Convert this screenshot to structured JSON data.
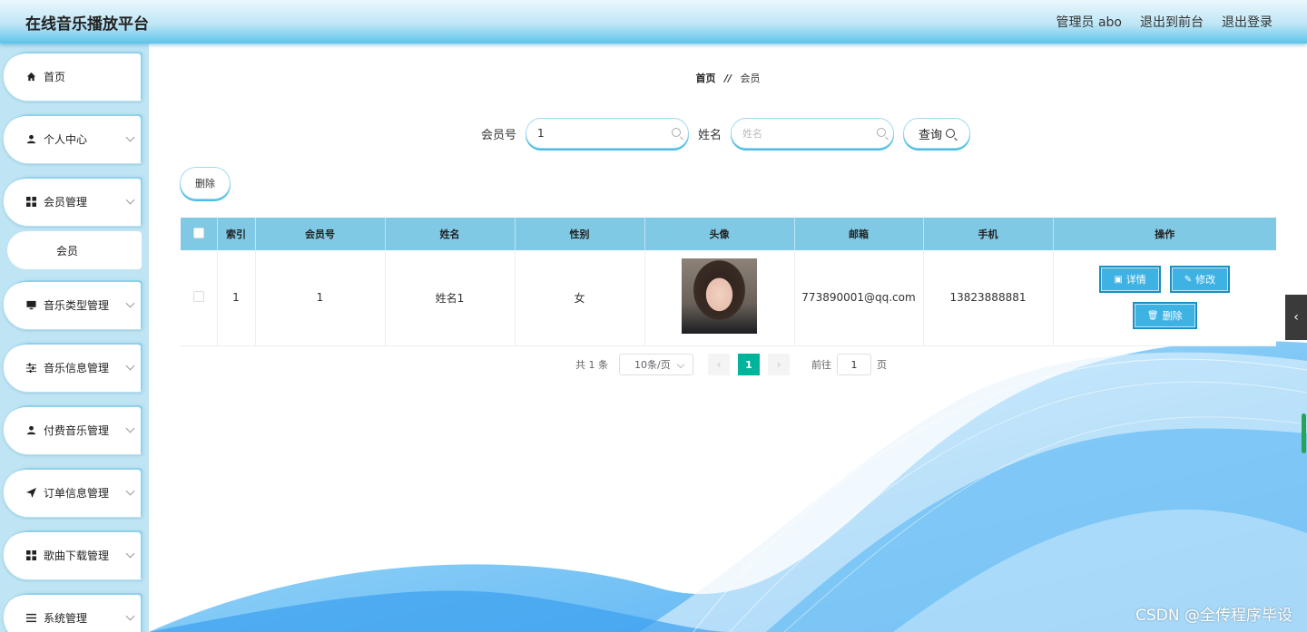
{
  "header": {
    "title": "在线音乐播放平台",
    "nav": [
      "管理员 abo",
      "退出到前台",
      "退出登录"
    ]
  },
  "sidebar": {
    "items": [
      {
        "label": "首页",
        "icon": "home-icon"
      },
      {
        "label": "个人中心",
        "icon": "user-icon"
      },
      {
        "label": "会员管理",
        "icon": "grid-icon"
      },
      {
        "label": "会员",
        "sub": true
      },
      {
        "label": "音乐类型管理",
        "icon": "monitor-icon"
      },
      {
        "label": "音乐信息管理",
        "icon": "sliders-icon"
      },
      {
        "label": "付费音乐管理",
        "icon": "user-icon"
      },
      {
        "label": "订单信息管理",
        "icon": "send-icon"
      },
      {
        "label": "歌曲下载管理",
        "icon": "grid-icon"
      },
      {
        "label": "系统管理",
        "icon": "list-icon"
      }
    ]
  },
  "breadcrumb": {
    "home": "首页",
    "sep": "//",
    "current": "会员"
  },
  "search": {
    "member_label": "会员号",
    "member_value": "1",
    "name_label": "姓名",
    "name_placeholder": "姓名",
    "query_label": "查询"
  },
  "toolbar": {
    "delete_label": "删除"
  },
  "table": {
    "columns": [
      "索引",
      "会员号",
      "姓名",
      "性别",
      "头像",
      "邮箱",
      "手机",
      "操作"
    ],
    "rows": [
      {
        "index": "1",
        "member_no": "1",
        "name": "姓名1",
        "gender": "女",
        "email": "773890001@qq.com",
        "phone": "13823888881"
      }
    ],
    "actions": {
      "detail": "详情",
      "edit": "修改",
      "delete": "删除"
    }
  },
  "pagination": {
    "total": "共 1 条",
    "page_size": "10条/页",
    "current_page": "1",
    "goto_label": "前往",
    "goto_value": "1",
    "page_suffix": "页"
  },
  "watermark": "CSDN @全传程序毕设",
  "colors": {
    "accent": "#3eb2e3",
    "header_bottom": "#5ec3ea",
    "pager_active": "#00b39b",
    "table_head": "#7fc9e4"
  }
}
